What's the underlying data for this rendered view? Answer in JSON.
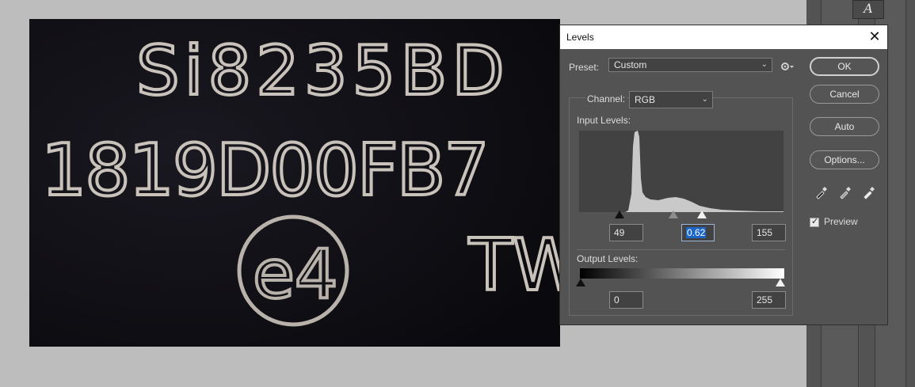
{
  "toolbar": {
    "type_tool_glyph": "A"
  },
  "photo": {
    "line1": "Si8235BD",
    "line2": "1819D00FB7",
    "logo_text": "e4",
    "line3": "TW"
  },
  "dialog": {
    "title": "Levels",
    "close_glyph": "✕",
    "preset_label": "Preset:",
    "preset_value": "Custom",
    "channel_label": "Channel:",
    "channel_value": "RGB",
    "input_levels_label": "Input Levels:",
    "input_black": "49",
    "input_gamma": "0.62",
    "input_white": "155",
    "output_levels_label": "Output Levels:",
    "output_black": "0",
    "output_white": "255",
    "buttons": {
      "ok": "OK",
      "cancel": "Cancel",
      "auto": "Auto",
      "options": "Options..."
    },
    "preview_label": "Preview",
    "preview_checked": true,
    "icons": [
      "gear-icon",
      "black-eyedropper-icon",
      "gray-eyedropper-icon",
      "white-eyedropper-icon"
    ]
  },
  "colors": {
    "dialog_bg": "#535353",
    "field_bg": "#424242",
    "selection": "#1c66c7",
    "canvas_bg": "#bdbdbd"
  }
}
